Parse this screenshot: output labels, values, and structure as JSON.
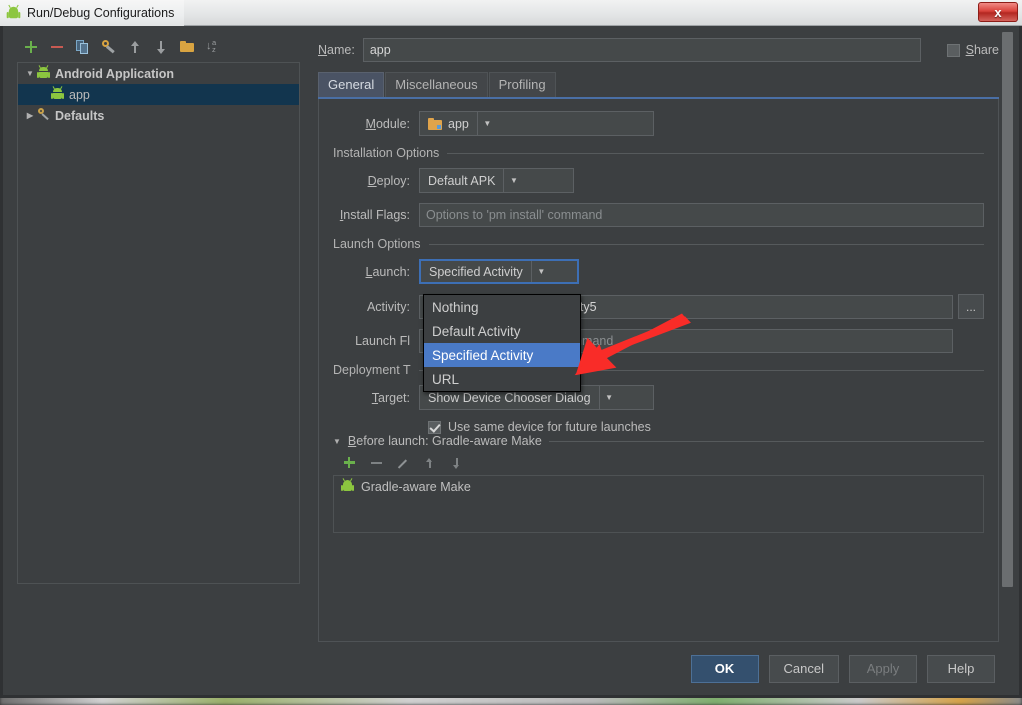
{
  "window": {
    "title": "Run/Debug Configurations",
    "close_label": "x",
    "app_icon": "android-icon"
  },
  "tree_toolbar": [
    {
      "name": "add-configuration-button",
      "icon": "plus-icon"
    },
    {
      "name": "remove-configuration-button",
      "icon": "minus-icon"
    },
    {
      "name": "copy-configuration-button",
      "icon": "copy-icon"
    },
    {
      "name": "edit-defaults-button",
      "icon": "wrench-icon"
    },
    {
      "name": "move-up-button",
      "icon": "arrow-up-icon"
    },
    {
      "name": "move-down-button",
      "icon": "arrow-down-icon"
    },
    {
      "name": "create-folder-button",
      "icon": "folder-icon"
    },
    {
      "name": "sort-configurations-button",
      "icon": "sort-alpha-icon"
    }
  ],
  "tree": {
    "nodes": [
      {
        "label": "Android Application",
        "icon": "android-icon",
        "expanded": true,
        "selected": false,
        "level": 0
      },
      {
        "label": "app",
        "icon": "android-icon",
        "expanded": null,
        "selected": true,
        "level": 1
      },
      {
        "label": "Defaults",
        "icon": "wrench-icon",
        "expanded": false,
        "selected": false,
        "level": 0
      }
    ]
  },
  "form": {
    "name_label": "Name:",
    "name_value": "app",
    "share_label": "Share",
    "share_checked": false
  },
  "tabs": [
    {
      "label": "General",
      "active": true
    },
    {
      "label": "Miscellaneous",
      "active": false
    },
    {
      "label": "Profiling",
      "active": false
    }
  ],
  "general": {
    "module_label": "Module:",
    "module_value": "app",
    "installation_section": "Installation Options",
    "deploy_label": "Deploy:",
    "deploy_value": "Default APK",
    "install_flags_label": "Install Flags:",
    "install_flags_placeholder": "Options to 'pm install' command",
    "launch_section": "Launch Options",
    "launch_label": "Launch:",
    "launch_value": "Specified Activity",
    "activity_label": "Activity:",
    "activity_value": "Activity5",
    "activity_browse_label": "...",
    "launch_flags_label": "Launch Fl",
    "launch_flags_placeholder": "art' command",
    "deployment_section": "Deployment T",
    "target_label": "Target:",
    "target_value": "Show Device Chooser Dialog",
    "same_device_label": "Use same device for future launches",
    "same_device_checked": true
  },
  "launch_dropdown": {
    "open": true,
    "items": [
      {
        "label": "Nothing",
        "selected": false
      },
      {
        "label": "Default Activity",
        "selected": false
      },
      {
        "label": "Specified Activity",
        "selected": true
      },
      {
        "label": "URL",
        "selected": false
      }
    ]
  },
  "before_launch": {
    "header": "Before launch: Gradle-aware Make",
    "toolbar": [
      {
        "name": "add-task-button",
        "icon": "plus-icon"
      },
      {
        "name": "remove-task-button",
        "icon": "minus-icon"
      },
      {
        "name": "edit-task-button",
        "icon": "pencil-icon"
      },
      {
        "name": "move-task-up-button",
        "icon": "arrow-up-icon"
      },
      {
        "name": "move-task-down-button",
        "icon": "arrow-down-icon"
      }
    ],
    "tasks": [
      {
        "label": "Gradle-aware Make",
        "icon": "android-icon"
      }
    ]
  },
  "buttons": {
    "ok": "OK",
    "cancel": "Cancel",
    "apply": "Apply",
    "help": "Help",
    "apply_disabled": true
  },
  "annotation": {
    "type": "red-arrow",
    "color": "#f92c28"
  },
  "colors": {
    "dialog_bg": "#3c3f41",
    "selection_blue": "#4a7ac7",
    "tree_selection": "#12354e",
    "accent_focus": "#3d6fb5",
    "android_green": "#8cc63f",
    "annotation_red": "#f92c28"
  }
}
